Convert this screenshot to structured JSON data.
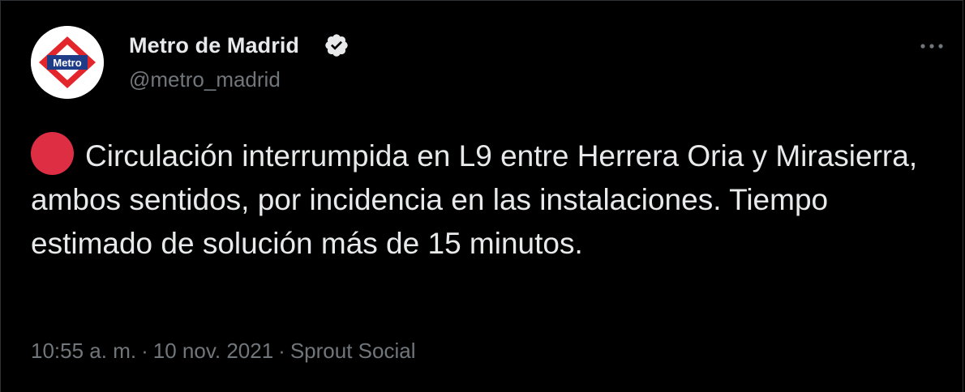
{
  "author": {
    "name": "Metro de Madrid",
    "handle": "@metro_madrid",
    "verified": true,
    "avatar_logo_text": "Metro"
  },
  "tweet": {
    "status_icon": "red-circle-emoji",
    "text": "Circulación interrumpida en L9 entre Herrera Oria y Mirasierra, ambos sentidos, por incidencia en las instalaciones. Tiempo estimado de solución más de 15 minutos.",
    "time": "10:55 a. m.",
    "date": "10 nov. 2021",
    "source": "Sprout Social",
    "separator": "·"
  },
  "colors": {
    "background": "#000000",
    "text": "#e7e9ea",
    "secondary": "#71767b",
    "logo_red": "#e3262b",
    "logo_blue": "#1f3c88",
    "status_red": "#dd2e44"
  }
}
